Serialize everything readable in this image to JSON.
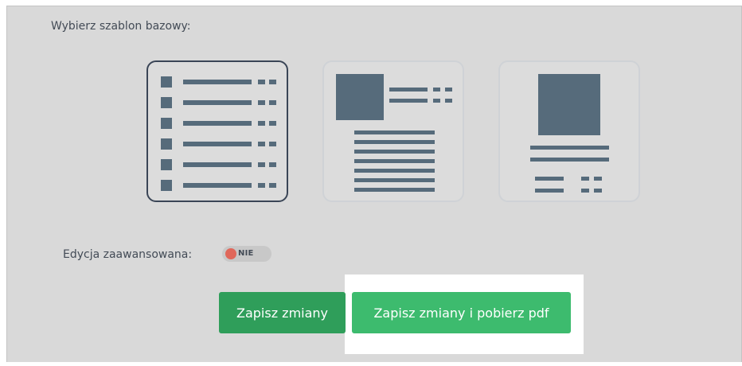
{
  "template_section": {
    "label": "Wybierz szablon bazowy:",
    "templates": [
      {
        "name": "list",
        "selected": true
      },
      {
        "name": "image-left-text",
        "selected": false
      },
      {
        "name": "image-top-text",
        "selected": false
      }
    ]
  },
  "advanced_edit": {
    "label": "Edycja zaawansowana:",
    "toggle_text": "NIE",
    "enabled": false
  },
  "actions": {
    "save_label": "Zapisz zmiany",
    "save_pdf_label": "Zapisz zmiany i pobierz pdf"
  },
  "colors": {
    "panel_bg": "#d9d9d9",
    "icon_fill": "#566b7b",
    "selected_border": "#3a4556",
    "toggle_off": "#e0675a",
    "button_dark_green": "#2f9e5a",
    "button_green": "#3dbb6e"
  }
}
